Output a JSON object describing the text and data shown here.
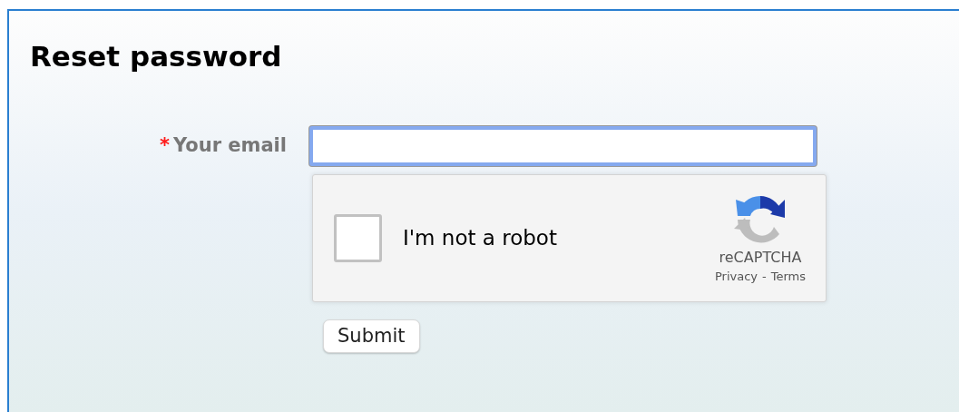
{
  "title": "Reset password",
  "email_field": {
    "label": "Your email",
    "required": true,
    "required_mark": "*",
    "focused": true
  },
  "captcha": {
    "label": "I'm not a robot",
    "checked": false,
    "brand": "reCAPTCHA",
    "separator": "-",
    "links": [
      {
        "label": "Privacy"
      },
      {
        "label": "Terms"
      }
    ]
  },
  "submit": {
    "label": "Submit"
  }
}
